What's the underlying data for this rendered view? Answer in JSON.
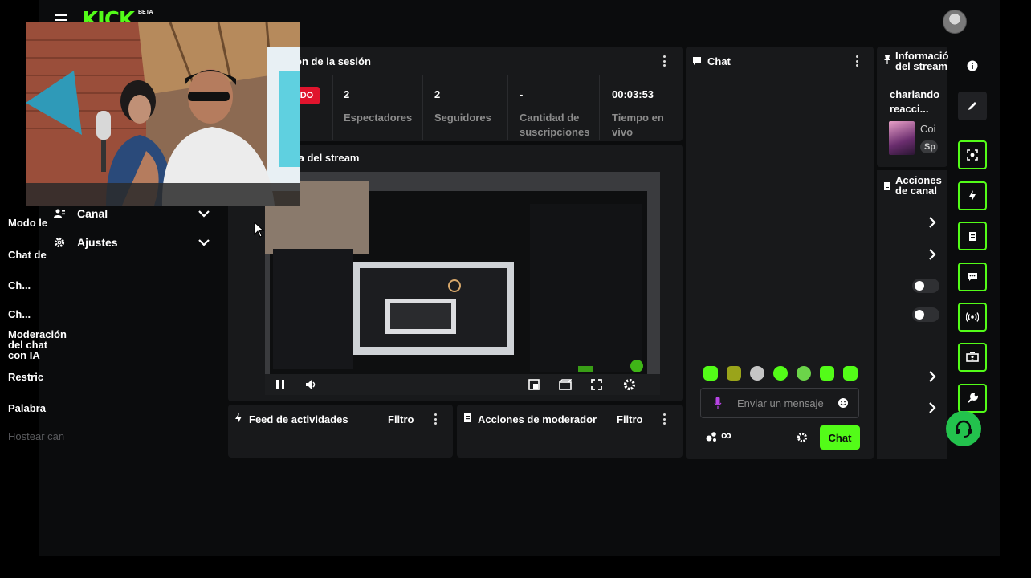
{
  "header": {
    "logo": "KICK",
    "logo_badge": "BETA"
  },
  "sidebar": {
    "items": [
      {
        "label": "Canal",
        "icon": "users-icon"
      },
      {
        "label": "Ajustes",
        "icon": "gear-icon"
      }
    ]
  },
  "session": {
    "title": "ón de la sesión",
    "live_badge": "NDO",
    "stats": [
      {
        "value": "2",
        "label": "Espectadores"
      },
      {
        "value": "2",
        "label": "Seguidores"
      },
      {
        "value": "-",
        "label": "Cantidad de suscripciones"
      },
      {
        "value": "00:03:53",
        "label": "Tiempo en vivo"
      }
    ]
  },
  "preview": {
    "title": "ia del stream"
  },
  "activity_feed": {
    "title": "Feed de actividades",
    "filter_label": "Filtro"
  },
  "mod_actions": {
    "title": "Acciones de moderador",
    "filter_label": "Filtro"
  },
  "chat": {
    "title": "Chat",
    "placeholder": "Enviar un mensaje",
    "send_label": "Chat",
    "infinity": "∞"
  },
  "stream_info": {
    "title": "Informació del stream",
    "title_line1": "Informació",
    "title_line2": "del stream",
    "stream_title_line1": "charlando",
    "stream_title_line2": "reacci...",
    "category": "Coi",
    "tag": "Sp"
  },
  "channel_actions": {
    "title_line1": "Acciones",
    "title_line2": "de canal",
    "items": [
      {
        "label": "Modo le",
        "kind": "chevron"
      },
      {
        "label": "Chat de",
        "kind": "chevron"
      },
      {
        "label": "Ch...",
        "kind": "toggle"
      },
      {
        "label": "Ch...",
        "kind": "toggle"
      },
      {
        "label": "Moderación del chat con IA",
        "kind": "heading"
      },
      {
        "label": "Restric",
        "kind": "chevron"
      },
      {
        "label": "Palabra",
        "kind": "chevron"
      },
      {
        "label": "Hostear can",
        "kind": "disabled"
      }
    ],
    "ai_line1": "Moderación",
    "ai_line2": "del chat",
    "ai_line3": "con IA"
  },
  "colors": {
    "accent": "#53fc18",
    "panel": "#18191b",
    "background": "#0b0c0d",
    "live": "#e0142d"
  }
}
